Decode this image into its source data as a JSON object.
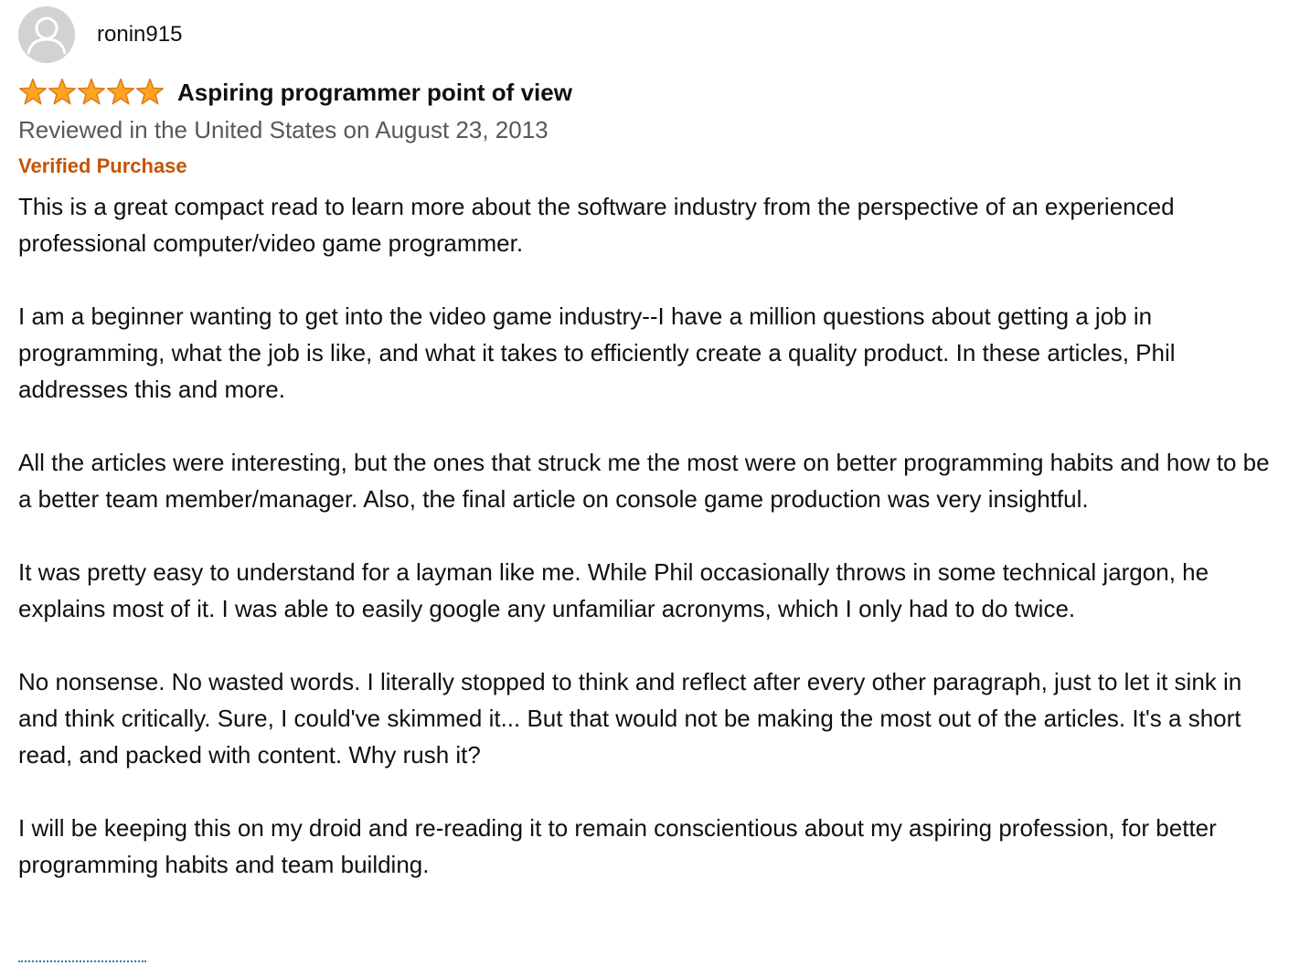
{
  "review": {
    "profile_name": "ronin915",
    "rating": 5,
    "rating_max": 5,
    "title": "Aspiring programmer point of view",
    "date_line": "Reviewed in the United States on August 23, 2013",
    "verified_label": "Verified Purchase",
    "paragraphs": [
      "This is a great compact read to learn more about the software industry from the perspective of an experienced professional computer/video game programmer.",
      "I am a beginner wanting to get into the video game industry--I have a million questions about getting a job in programming, what the job is like, and what it takes to efficiently create a quality product. In these articles, Phil addresses this and more.",
      "All the articles were interesting, but the ones that struck me the most were on better programming habits and how to be a better team member/manager. Also, the final article on console game production was very insightful.",
      "It was pretty easy to understand for a layman like me. While Phil occasionally throws in some technical jargon, he explains most of it. I was able to easily google any unfamiliar acronyms, which I only had to do twice.",
      "No nonsense. No wasted words. I literally stopped to think and reflect after every other paragraph, just to let it sink in and think critically. Sure, I could've skimmed it... But that would not be making the most out of the articles. It's a short read, and packed with content. Why rush it?",
      "I will be keeping this on my droid and re-reading it to remain conscientious about my aspiring profession, for better programming habits and team building."
    ]
  },
  "colors": {
    "star_fill": "#ffa41c",
    "star_stroke": "#de7921",
    "verified": "#c45500",
    "secondary_text": "#565959",
    "avatar_bg": "#d0d2d3"
  },
  "icons": {
    "avatar": "default-user-avatar-icon",
    "star": "star-filled-icon"
  }
}
